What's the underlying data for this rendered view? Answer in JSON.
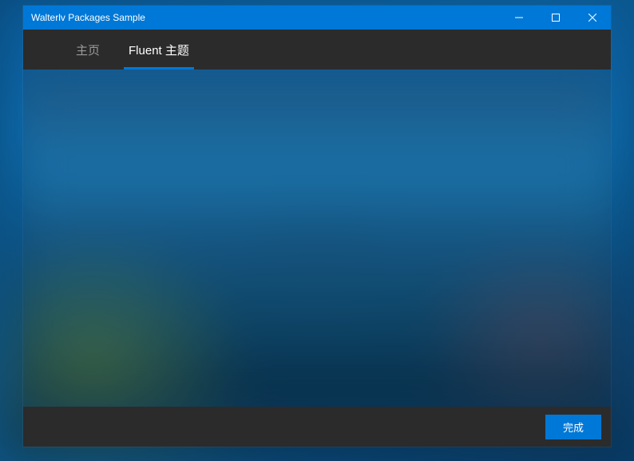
{
  "window": {
    "title": "Walterlv Packages Sample"
  },
  "tabs": {
    "home": "主页",
    "fluent": "Fluent 主题"
  },
  "footer": {
    "done_label": "完成"
  }
}
